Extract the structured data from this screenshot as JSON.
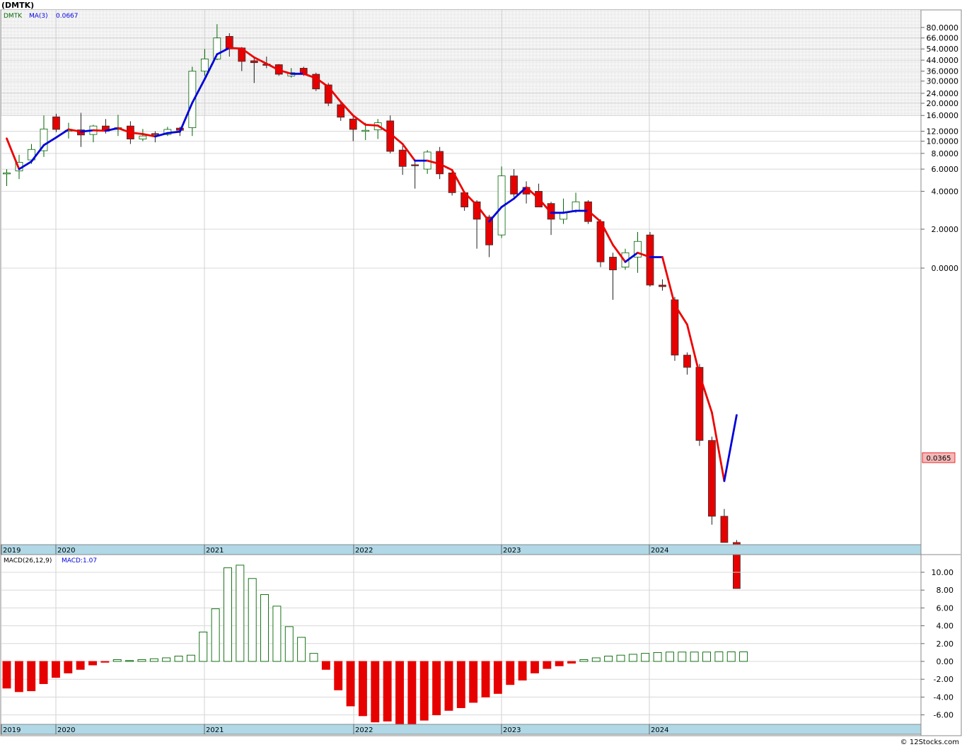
{
  "title": "(DMTK)",
  "legend": {
    "symbol": "DMTK",
    "ma_label": "MA(3)",
    "ma_value": "0.0667"
  },
  "macd_legend": {
    "label": "MACD(26,12,9)",
    "value_label": "MACD:1.07"
  },
  "last_price_label": "0.0365",
  "watermark": "© 12Stocks.com",
  "colors": {
    "up": "#006400",
    "down": "#e60000",
    "ma_up": "#0000dd",
    "ma_down": "#ee0000",
    "axis_band": "#b0d8e6"
  },
  "chart_data": [
    {
      "type": "candlestick",
      "scale": "log",
      "price_ticks": [
        "80.0000",
        "66.0000",
        "54.0000",
        "44.0000",
        "36.0000",
        "30.0000",
        "24.0000",
        "20.0000",
        "16.0000",
        "12.0000",
        "10.0000",
        "8.0000",
        "6.0000",
        "4.0000",
        "2.0000",
        "0.0000"
      ],
      "year_labels": [
        "2019",
        "2020",
        "2021",
        "2022",
        "2023",
        "2024"
      ],
      "candles": [
        {
          "o": 5.5,
          "h": 6.0,
          "l": 4.4,
          "c": 5.6
        },
        {
          "o": 5.8,
          "h": 7.8,
          "l": 5.0,
          "c": 6.8
        },
        {
          "o": 7.1,
          "h": 9.5,
          "l": 6.6,
          "c": 8.6
        },
        {
          "o": 8.4,
          "h": 16.0,
          "l": 7.5,
          "c": 12.5
        },
        {
          "o": 15.6,
          "h": 16.5,
          "l": 11.8,
          "c": 12.4
        },
        {
          "o": 12.1,
          "h": 14.0,
          "l": 10.5,
          "c": 12.2
        },
        {
          "o": 12.3,
          "h": 16.8,
          "l": 9.0,
          "c": 11.2
        },
        {
          "o": 11.3,
          "h": 13.5,
          "l": 9.8,
          "c": 13.2
        },
        {
          "o": 13.2,
          "h": 15.0,
          "l": 11.5,
          "c": 12.0
        },
        {
          "o": 12.4,
          "h": 16.2,
          "l": 11.0,
          "c": 12.8
        },
        {
          "o": 13.2,
          "h": 14.4,
          "l": 9.5,
          "c": 10.4
        },
        {
          "o": 10.4,
          "h": 12.5,
          "l": 10.0,
          "c": 11.0
        },
        {
          "o": 11.5,
          "h": 12.0,
          "l": 9.8,
          "c": 11.3
        },
        {
          "o": 11.3,
          "h": 13.0,
          "l": 11.0,
          "c": 12.4
        },
        {
          "o": 12.7,
          "h": 13.0,
          "l": 11.0,
          "c": 12.2
        },
        {
          "o": 12.8,
          "h": 39.0,
          "l": 11.0,
          "c": 36.0
        },
        {
          "o": 36.0,
          "h": 54.0,
          "l": 33.0,
          "c": 45.0
        },
        {
          "o": 45.0,
          "h": 85.0,
          "l": 44.0,
          "c": 66.0
        },
        {
          "o": 68.0,
          "h": 72.0,
          "l": 47.0,
          "c": 54.0
        },
        {
          "o": 55.0,
          "h": 56.0,
          "l": 36.0,
          "c": 43.0
        },
        {
          "o": 43.5,
          "h": 46.0,
          "l": 29.0,
          "c": 42.0
        },
        {
          "o": 41.0,
          "h": 47.0,
          "l": 38.0,
          "c": 40.0
        },
        {
          "o": 40.5,
          "h": 41.0,
          "l": 33.0,
          "c": 34.0
        },
        {
          "o": 33.0,
          "h": 38.0,
          "l": 32.0,
          "c": 35.0
        },
        {
          "o": 38.0,
          "h": 39.0,
          "l": 33.0,
          "c": 34.0
        },
        {
          "o": 34.0,
          "h": 35.0,
          "l": 25.0,
          "c": 26.0
        },
        {
          "o": 28.0,
          "h": 29.0,
          "l": 19.0,
          "c": 20.0
        },
        {
          "o": 19.5,
          "h": 20.0,
          "l": 14.5,
          "c": 15.5
        },
        {
          "o": 15.0,
          "h": 16.0,
          "l": 10.0,
          "c": 12.4
        },
        {
          "o": 12.0,
          "h": 14.0,
          "l": 10.2,
          "c": 12.2
        },
        {
          "o": 12.3,
          "h": 15.0,
          "l": 10.4,
          "c": 14.0
        },
        {
          "o": 14.5,
          "h": 16.0,
          "l": 8.0,
          "c": 8.3
        },
        {
          "o": 8.5,
          "h": 9.2,
          "l": 5.4,
          "c": 6.3
        },
        {
          "o": 6.5,
          "h": 7.0,
          "l": 4.2,
          "c": 6.4
        },
        {
          "o": 6.0,
          "h": 8.5,
          "l": 5.5,
          "c": 8.2
        },
        {
          "o": 8.3,
          "h": 9.0,
          "l": 5.0,
          "c": 5.5
        },
        {
          "o": 5.6,
          "h": 6.0,
          "l": 3.7,
          "c": 3.9
        },
        {
          "o": 3.9,
          "h": 4.0,
          "l": 2.8,
          "c": 3.0
        },
        {
          "o": 3.3,
          "h": 3.4,
          "l": 1.4,
          "c": 2.4
        },
        {
          "o": 2.5,
          "h": 2.6,
          "l": 1.2,
          "c": 1.5
        },
        {
          "o": 1.8,
          "h": 6.3,
          "l": 1.7,
          "c": 5.3
        },
        {
          "o": 5.3,
          "h": 6.0,
          "l": 3.6,
          "c": 3.8
        },
        {
          "o": 4.3,
          "h": 4.8,
          "l": 3.2,
          "c": 3.8
        },
        {
          "o": 4.0,
          "h": 4.6,
          "l": 3.0,
          "c": 3.0
        },
        {
          "o": 3.2,
          "h": 3.3,
          "l": 1.8,
          "c": 2.4
        },
        {
          "o": 2.4,
          "h": 3.5,
          "l": 2.2,
          "c": 2.7
        },
        {
          "o": 2.8,
          "h": 3.9,
          "l": 2.7,
          "c": 3.3
        },
        {
          "o": 3.3,
          "h": 3.4,
          "l": 2.2,
          "c": 2.3
        },
        {
          "o": 2.3,
          "h": 2.4,
          "l": 1.0,
          "c": 1.1
        },
        {
          "o": 1.2,
          "h": 1.3,
          "l": 0.55,
          "c": 0.95
        },
        {
          "o": 1.0,
          "h": 1.4,
          "l": 0.95,
          "c": 1.3
        },
        {
          "o": 1.2,
          "h": 1.9,
          "l": 0.9,
          "c": 1.6
        },
        {
          "o": 1.8,
          "h": 1.9,
          "l": 0.7,
          "c": 0.72
        },
        {
          "o": 0.72,
          "h": 0.8,
          "l": 0.65,
          "c": 0.7
        },
        {
          "o": 0.55,
          "h": 0.58,
          "l": 0.18,
          "c": 0.2
        },
        {
          "o": 0.2,
          "h": 0.21,
          "l": 0.14,
          "c": 0.16
        },
        {
          "o": 0.16,
          "h": 0.17,
          "l": 0.038,
          "c": 0.042
        },
        {
          "o": 0.042,
          "h": 0.045,
          "l": 0.009,
          "c": 0.0105
        },
        {
          "o": 0.0105,
          "h": 0.012,
          "l": 0.0068,
          "c": 0.0065
        },
        {
          "o": 0.0065,
          "h": 0.0068,
          "l": 0.00035,
          "c": 0.0028
        }
      ],
      "ma3": [
        10.5,
        6.0,
        6.9,
        9.3,
        10.7,
        12.4,
        11.9,
        12.2,
        12.1,
        12.7,
        11.7,
        11.4,
        10.9,
        11.6,
        11.9,
        20.2,
        31.1,
        49.0,
        55.0,
        54.3,
        46.3,
        41.3,
        36.7,
        34.3,
        34.3,
        31.7,
        27.0,
        20.5,
        16.0,
        13.5,
        13.3,
        11.5,
        9.5,
        7.0,
        7.0,
        6.6,
        5.9,
        3.9,
        3.1,
        2.3,
        3.0,
        3.5,
        4.3,
        3.5,
        2.7,
        2.7,
        2.8,
        2.8,
        2.3,
        1.5,
        1.1,
        1.3,
        1.2,
        1.2,
        0.5,
        0.35,
        0.14,
        0.07,
        0.02,
        0.0667
      ]
    },
    {
      "type": "bar",
      "title": "MACD(26,12,9)",
      "y_ticks": [
        "10.00",
        "8.00",
        "6.00",
        "4.00",
        "2.00",
        "0.00",
        "-2.00",
        "-4.00",
        "-6.00"
      ],
      "year_labels": [
        "2019",
        "2020",
        "2021",
        "2022",
        "2023",
        "2024"
      ],
      "values": [
        -3.0,
        -3.4,
        -3.3,
        -2.5,
        -1.8,
        -1.3,
        -0.9,
        -0.4,
        -0.1,
        0.2,
        0.1,
        0.2,
        0.3,
        0.4,
        0.6,
        0.7,
        3.3,
        5.9,
        10.5,
        10.8,
        9.3,
        7.5,
        6.2,
        3.9,
        2.7,
        0.9,
        -0.9,
        -3.2,
        -5.0,
        -6.1,
        -6.8,
        -6.7,
        -7.0,
        -7.1,
        -6.6,
        -6.0,
        -5.5,
        -5.2,
        -4.6,
        -4.0,
        -3.6,
        -2.6,
        -2.1,
        -1.3,
        -0.8,
        -0.5,
        -0.2,
        0.2,
        0.4,
        0.6,
        0.7,
        0.8,
        0.9,
        1.0,
        1.05,
        1.05,
        1.05,
        1.05,
        1.07,
        1.07,
        1.07
      ]
    }
  ]
}
